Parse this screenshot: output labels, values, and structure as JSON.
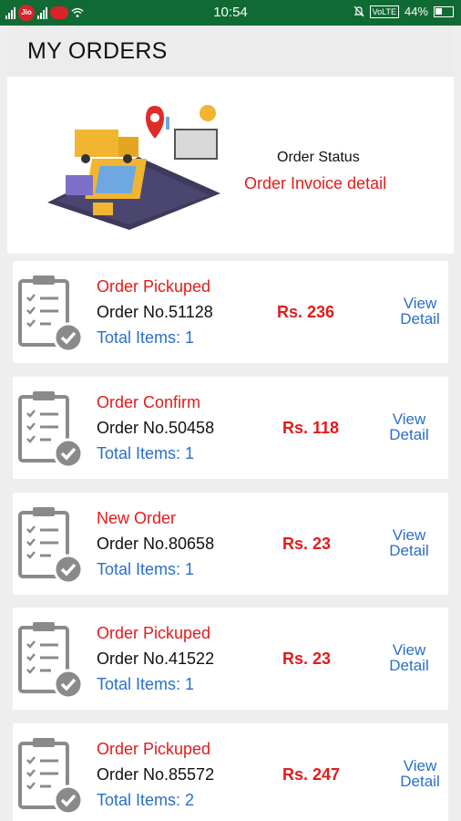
{
  "status_bar": {
    "carrier_badge": "Jio",
    "time": "10:54",
    "volte": "VoLTE",
    "battery": "44%"
  },
  "header": {
    "title": "MY ORDERS"
  },
  "banner": {
    "order_status": "Order Status",
    "invoice_detail": "Order Invoice detail"
  },
  "orders": [
    {
      "status": "Order Pickuped",
      "order_no": "Order No.51128",
      "price": "Rs. 236",
      "items": "Total Items: 1",
      "view": "View",
      "detail": "Detail"
    },
    {
      "status": "Order Confirm",
      "order_no": "Order No.50458",
      "price": "Rs. 118",
      "items": "Total Items: 1",
      "view": "View",
      "detail": "Detail"
    },
    {
      "status": "New Order",
      "order_no": "Order No.80658",
      "price": "Rs. 23",
      "items": "Total Items: 1",
      "view": "View",
      "detail": "Detail"
    },
    {
      "status": "Order Pickuped",
      "order_no": "Order No.41522",
      "price": "Rs. 23",
      "items": "Total Items: 1",
      "view": "View",
      "detail": "Detail"
    },
    {
      "status": "Order Pickuped",
      "order_no": "Order No.85572",
      "price": "Rs. 247",
      "items": "Total Items: 2",
      "view": "View",
      "detail": "Detail"
    }
  ],
  "colors": {
    "status_bar": "#0f6b33",
    "accent_red": "#e21b1b",
    "accent_blue": "#2a6fc9",
    "background": "#eeeeee"
  },
  "icons": [
    "signal-icon",
    "wifi-icon",
    "mute-icon",
    "battery-icon",
    "order-clipboard-icon",
    "check-icon",
    "delivery-illustration"
  ]
}
